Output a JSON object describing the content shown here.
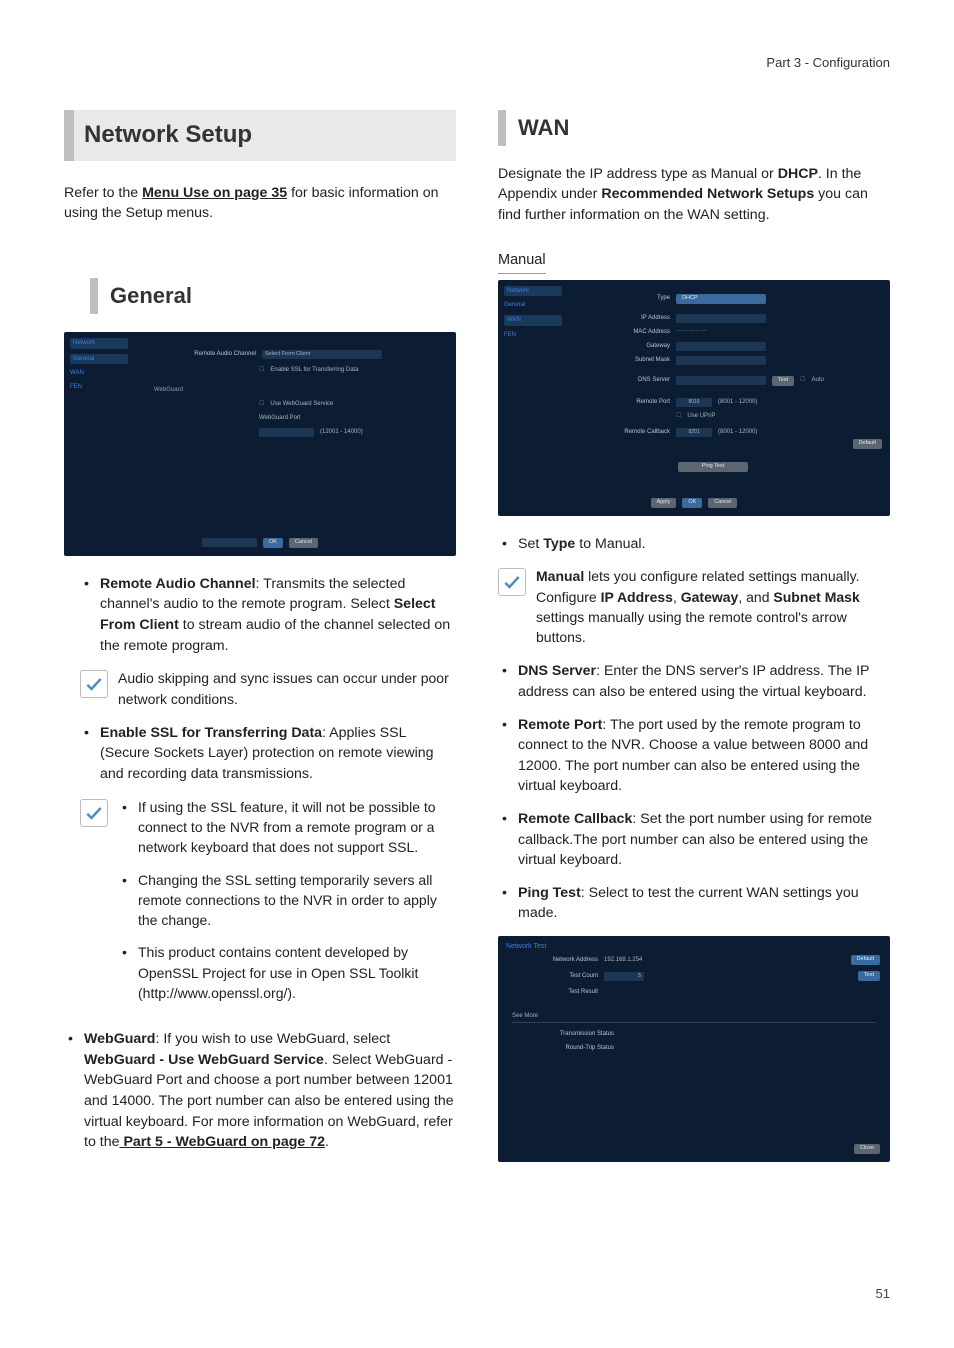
{
  "header": {
    "part": "Part 3 - Configuration"
  },
  "page_number": "51",
  "left": {
    "title_main": "Network Setup",
    "intro_pre": "Refer to the ",
    "intro_link": "Menu Use on page 35",
    "intro_post": " for basic information on using the Setup menus.",
    "title_general": "General",
    "shot_general": {
      "sidebar": [
        "Network",
        "General",
        "WAN",
        "FEN"
      ],
      "row1_label": "Remote Audio Channel",
      "row1_value": "Select From Client",
      "row2_chk": "Enable SSL for Transferring Data",
      "webguard_group": "WebGuard",
      "row3_chk": "Use WebGuard Service",
      "row4_label": "WebGuard Port",
      "row4_range": "(12001 - 14000)",
      "btn_ok": "OK",
      "btn_cancel": "Cancel"
    },
    "item1_title": "Remote Audio Channel",
    "item1_body": ": Transmits the selected channel's audio to the remote program. Select ",
    "item1_bold": "Select From Client",
    "item1_tail": " to stream audio of the channel selected on the remote program.",
    "note1": "Audio skipping and sync issues can occur under poor network conditions.",
    "item2_title": "Enable SSL for Transferring Data",
    "item2_body": ": Applies SSL (Secure Sockets Layer) protection on remote viewing and recording data transmissions.",
    "note2a": "If using the SSL feature, it will not be possible to connect to the NVR from a remote program or a network keyboard that does not support SSL.",
    "note2b": "Changing the SSL setting temporarily severs all remote connections to the NVR in order to apply the change.",
    "note2c": "This product contains content developed by OpenSSL Project for use in Open SSL Toolkit (http://www.openssl.org/).",
    "item3_title": "WebGuard",
    "item3_body1": ": If you wish to use WebGuard, select ",
    "item3_bold": "WebGuard - Use WebGuard Service",
    "item3_body2": ". Select WebGuard - WebGuard Port and choose a port number between 12001 and 14000. The port number can also be entered using the virtual keyboard. For more information on WebGuard, refer to the",
    "item3_link": " Part 5 - WebGuard on page 72",
    "item3_tail": "."
  },
  "right": {
    "title_wan": "WAN",
    "intro1": "Designate the IP address type as Manual or ",
    "intro_bold1": "DHCP",
    "intro2": ".  In the Appendix under ",
    "intro_bold2": "Recommended Network Setups",
    "intro3": " you can find further information on the WAN setting.",
    "subhead": "Manual",
    "shot_wan": {
      "sidebar": [
        "Network",
        "General",
        "WAN",
        "FEN"
      ],
      "type_label": "Type",
      "type_value": "DHCP",
      "ip_label": "IP Address",
      "mac_label": "MAC Address",
      "gw_label": "Gateway",
      "mask_label": "Subnet Mask",
      "dns_label": "DNS Server",
      "dns_test": "Test",
      "dns_auto": "Auto",
      "rport_label": "Remote Port",
      "rport_val": "8016",
      "rport_range": "(8001 - 12000)",
      "upnp": "Use UPnP",
      "rcb_label": "Remote Callback",
      "rcb_val": "8201",
      "rcb_range": "(8001 - 12000)",
      "default_btn": "Default",
      "ping_btn": "Ping Test",
      "apply": "Apply",
      "ok": "OK",
      "cancel": "Cancel"
    },
    "b_type_pre": "Set ",
    "b_type_bold": "Type",
    "b_type_post": " to Manual.",
    "note_manual_pre": "Manual",
    "note_manual_mid1": " lets you configure related settings manually. Configure ",
    "nm_b1": "IP Address",
    "nm_sep1": ", ",
    "nm_b2": "Gateway",
    "nm_sep2": ", and ",
    "nm_b3": "Subnet Mask",
    "note_manual_tail": " settings manually using the remote control's arrow buttons.",
    "b_dns_title": "DNS Server",
    "b_dns_body": ": Enter the DNS server's IP address. The IP address can also be entered using the virtual keyboard.",
    "b_rport_title": "Remote Port",
    "b_rport_body": ": The port used by the remote program to connect to the NVR. Choose a value between 8000 and 12000. The port number can also be entered using the virtual keyboard.",
    "b_rcb_title": "Remote Callback",
    "b_rcb_body": ": Set the port number using for remote callback.The port number can also be entered using the virtual keyboard.",
    "b_ping_title": "Ping Test",
    "b_ping_body": ": Select to test the current WAN settings you made.",
    "shot_ping": {
      "title": "Network Test",
      "addr_label": "Network Address",
      "addr_value": "192.168.1.254",
      "default_btn": "Default",
      "count_label": "Test Count",
      "count_value": "5",
      "test_btn": "Test",
      "result_label": "Test Result",
      "more": "See More",
      "tx": "Transmission Status",
      "rt": "Round-Trip Status",
      "close": "Close"
    }
  }
}
